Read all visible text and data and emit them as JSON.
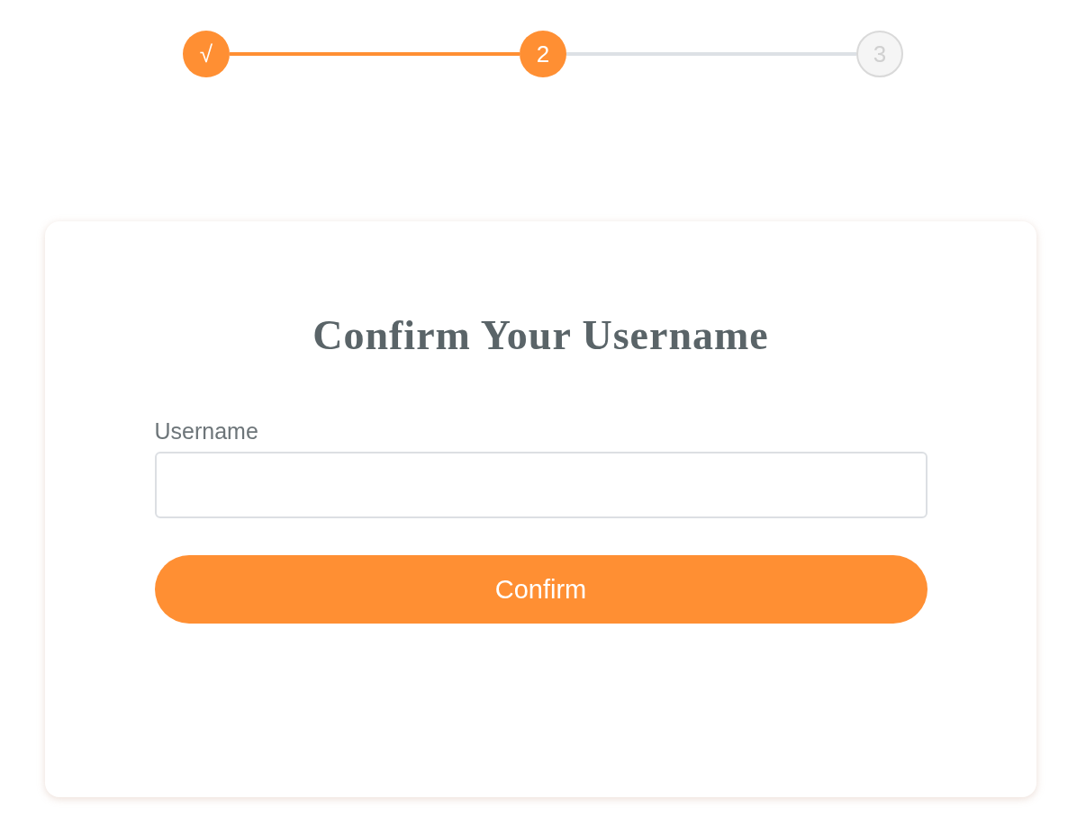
{
  "steps": [
    {
      "label": "√",
      "active": true
    },
    {
      "label": "2",
      "active": true
    },
    {
      "label": "3",
      "active": false
    }
  ],
  "card": {
    "title": "Confirm Your Username",
    "field": {
      "label": "Username"
    },
    "button": "Confirm"
  }
}
